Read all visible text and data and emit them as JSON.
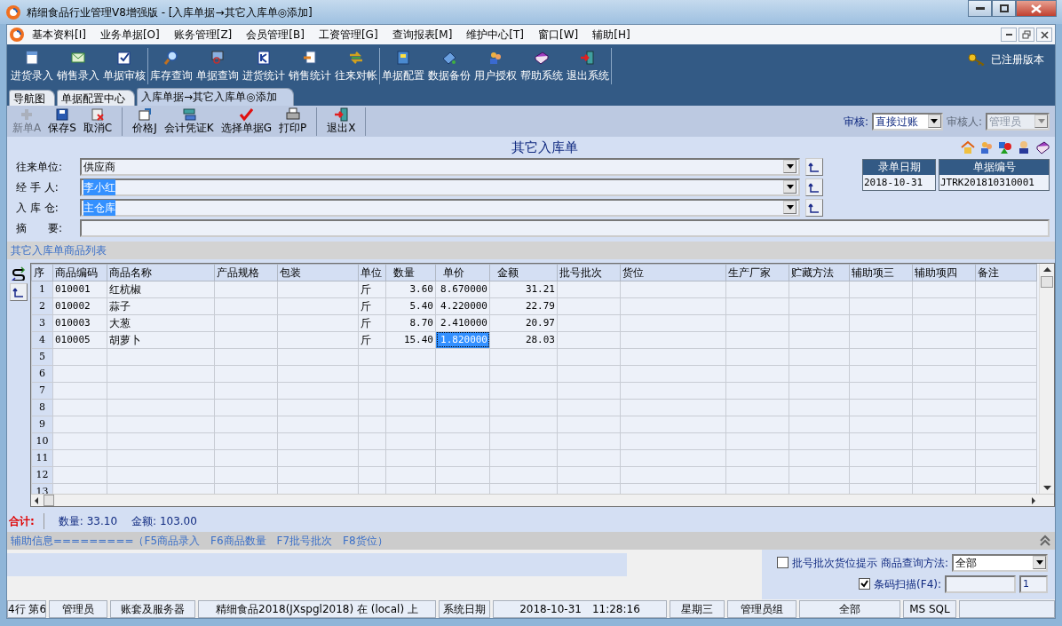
{
  "window": {
    "title": "精细食品行业管理V8增强版 - [入库单据→其它入库单◎添加]"
  },
  "menu": [
    "基本资料[I]",
    "业务单据[O]",
    "账务管理[Z]",
    "会员管理[B]",
    "工资管理[G]",
    "查询报表[M]",
    "维护中心[T]",
    "窗口[W]",
    "辅助[H]"
  ],
  "toolbar": {
    "groups": [
      [
        "进货录入",
        "销售录入",
        "单据审核"
      ],
      [
        "库存查询",
        "单据查询",
        "进货统计",
        "销售统计",
        "往来对帐"
      ],
      [
        "单据配置",
        "数据备份",
        "用户授权",
        "帮助系统",
        "退出系统"
      ]
    ],
    "registered": "已注册版本"
  },
  "tabs": [
    {
      "label": "导航图",
      "selected": false
    },
    {
      "label": "单据配置中心",
      "selected": false
    },
    {
      "label": "入库单据→其它入库单◎添加",
      "selected": true
    }
  ],
  "actions": {
    "groups": [
      [
        {
          "label": "新单A",
          "disabled": true
        },
        {
          "label": "保存S",
          "disabled": false
        },
        {
          "label": "取消C",
          "disabled": false
        }
      ],
      [
        {
          "label": "价格J",
          "disabled": false
        },
        {
          "label": "会计凭证K",
          "disabled": false
        },
        {
          "label": "选择单据G",
          "disabled": false
        },
        {
          "label": "打印P",
          "disabled": false
        }
      ],
      [
        {
          "label": "退出X",
          "disabled": false
        }
      ]
    ],
    "audit": {
      "label": "审核:",
      "value": "直接过账",
      "disabled": false
    },
    "auditor": {
      "label": "审核人:",
      "value": "管理员",
      "disabled": true
    }
  },
  "form": {
    "title": "其它入库单",
    "fields": [
      {
        "label": "往来单位:",
        "value": "供应商",
        "highlighted": false
      },
      {
        "label": "经 手 人:",
        "value": "李小红",
        "highlighted": true
      },
      {
        "label": "入 库 仓:",
        "value": "主仓库",
        "highlighted": true
      }
    ],
    "summary": {
      "label": "摘　　要:"
    },
    "date": {
      "label": "录单日期",
      "value": "2018-10-31"
    },
    "number": {
      "label": "单据编号",
      "value": "JTRK201810310001"
    }
  },
  "list_title": "其它入库单商品列表",
  "table": {
    "columns": [
      "序",
      "商品编码",
      "商品名称",
      "产品规格",
      "包装",
      "单位",
      "数量",
      "单价",
      "金额",
      "批号批次",
      "货位",
      "生产厂家",
      "贮藏方法",
      "辅助项三",
      "辅助项四",
      "备注"
    ],
    "rows": [
      {
        "no": "1",
        "cells": [
          {
            "text": "010001",
            "selected": false
          },
          {
            "text": "红杭椒",
            "selected": false
          },
          null,
          null,
          {
            "text": "斤",
            "selected": false
          },
          {
            "text": "3.60",
            "selected": false
          },
          {
            "text": "8.670000",
            "selected": false
          },
          {
            "text": "31.21",
            "selected": false
          }
        ]
      },
      {
        "no": "2",
        "cells": [
          {
            "text": "010002",
            "selected": false
          },
          {
            "text": "蒜子",
            "selected": false
          },
          null,
          null,
          {
            "text": "斤",
            "selected": false
          },
          {
            "text": "5.40",
            "selected": false
          },
          {
            "text": "4.220000",
            "selected": false
          },
          {
            "text": "22.79",
            "selected": false
          }
        ]
      },
      {
        "no": "3",
        "cells": [
          {
            "text": "010003",
            "selected": false
          },
          {
            "text": "大葱",
            "selected": false
          },
          null,
          null,
          {
            "text": "斤",
            "selected": false
          },
          {
            "text": "8.70",
            "selected": false
          },
          {
            "text": "2.410000",
            "selected": false
          },
          {
            "text": "20.97",
            "selected": false
          }
        ]
      },
      {
        "no": "4",
        "cells": [
          {
            "text": "010005",
            "selected": false
          },
          {
            "text": "胡萝卜",
            "selected": false
          },
          null,
          null,
          {
            "text": "斤",
            "selected": false
          },
          {
            "text": "15.40",
            "selected": false
          },
          {
            "text": "1.820000",
            "selected": true
          },
          {
            "text": "28.03",
            "selected": false
          }
        ]
      },
      {
        "no": "5"
      },
      {
        "no": "6"
      },
      {
        "no": "7"
      },
      {
        "no": "8"
      },
      {
        "no": "9"
      },
      {
        "no": "10"
      },
      {
        "no": "11"
      },
      {
        "no": "12"
      },
      {
        "no": "13"
      }
    ]
  },
  "totals": {
    "label": "合计:",
    "items": [
      {
        "label": "数量:",
        "value": "33.10"
      },
      {
        "label": "金额:",
        "value": "103.00"
      }
    ]
  },
  "aux_info": "辅助信息=========（F5商品录入　F6商品数量　F7批号批次　F8货位）",
  "options": {
    "batch_hint": {
      "label": "批号批次货位提示",
      "checked": false
    },
    "query_method": {
      "label": "商品查询方法:",
      "value": "全部"
    },
    "barcode": {
      "label": "条码扫描(F4):",
      "checked": true,
      "count": "1"
    }
  },
  "status_bar": [
    "4行 第6",
    "管理员",
    "账套及服务器",
    "精细食品2018(JXspgl2018) 在 (local) 上",
    "系统日期",
    "2018-10-31　11:28:16",
    "星期三",
    "管理员组",
    "全部",
    "MS SQL"
  ]
}
